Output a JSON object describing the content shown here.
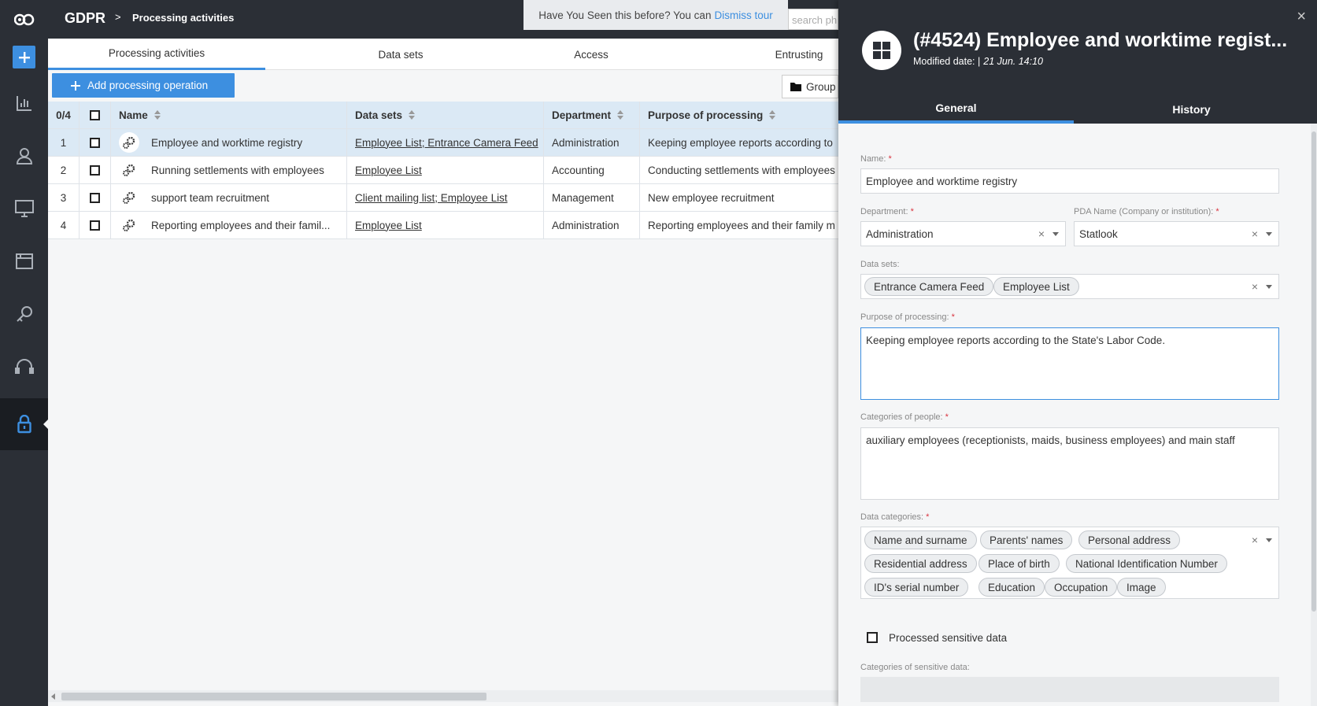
{
  "app": {
    "name": "GDPR",
    "breadcrumb_sep": ">",
    "page": "Processing activities"
  },
  "tour": {
    "text": "Have You Seen this before? You can",
    "link": "Dismiss tour"
  },
  "search": {
    "placeholder": "search phrase"
  },
  "tabs": [
    {
      "label": "Processing activities",
      "active": true
    },
    {
      "label": "Data sets"
    },
    {
      "label": "Access"
    },
    {
      "label": "Entrusting"
    }
  ],
  "toolbar": {
    "add_label": "Add processing operation",
    "group_label": "Group"
  },
  "table": {
    "count": "0/4",
    "columns": {
      "name": "Name",
      "datasets": "Data sets",
      "department": "Department",
      "purpose": "Purpose of processing"
    },
    "rows": [
      {
        "idx": "1",
        "name": "Employee and worktime registry",
        "datasets": "Employee List; Entrance Camera Feed",
        "department": "Administration",
        "purpose": "Keeping employee reports according to",
        "selected": true
      },
      {
        "idx": "2",
        "name": "Running settlements with employees",
        "datasets": "Employee List",
        "department": "Accounting",
        "purpose": "Conducting settlements with employees"
      },
      {
        "idx": "3",
        "name": "support team recruitment",
        "datasets": "Client mailing list; Employee List",
        "department": "Management",
        "purpose": "New employee recruitment"
      },
      {
        "idx": "4",
        "name": "Reporting employees and their famil...",
        "datasets": "Employee List",
        "department": "Administration",
        "purpose": "Reporting employees and their family m"
      }
    ]
  },
  "panel": {
    "title": "(#4524) Employee and worktime regist...",
    "modified_label": "Modified date: |",
    "modified_value": "21 Jun. 14:10",
    "close": "×",
    "tabs": {
      "general": "General",
      "history": "History"
    },
    "form": {
      "name_label": "Name:",
      "name_value": "Employee and worktime registry",
      "department_label": "Department:",
      "department_value": "Administration",
      "pda_label": "PDA Name (Company or institution):",
      "pda_value": "Statlook",
      "datasets_label": "Data sets:",
      "datasets": [
        "Entrance Camera Feed",
        "Employee List"
      ],
      "purpose_label": "Purpose of processing:",
      "purpose_value": "Keeping employee reports according to the State's Labor Code.",
      "people_label": "Categories of people:",
      "people_value": "auxiliary employees (receptionists, maids, business employees) and main staff",
      "datacat_label": "Data categories:",
      "datacats": [
        "Name and surname",
        "Parents' names",
        "Personal address",
        "Residential address",
        "Place of birth",
        "National Identification Number",
        "ID's serial number",
        "Education",
        "Occupation",
        "Image"
      ],
      "sensitive_label": "Processed sensitive data",
      "sensitive_checked": false,
      "sensitive_cat_label": "Categories of sensitive data:",
      "required_mark": "*"
    }
  },
  "colors": {
    "accent": "#3d8fe0",
    "dark": "#2b2f36",
    "selected_row": "#dbe9f5",
    "required": "#d9333f"
  }
}
